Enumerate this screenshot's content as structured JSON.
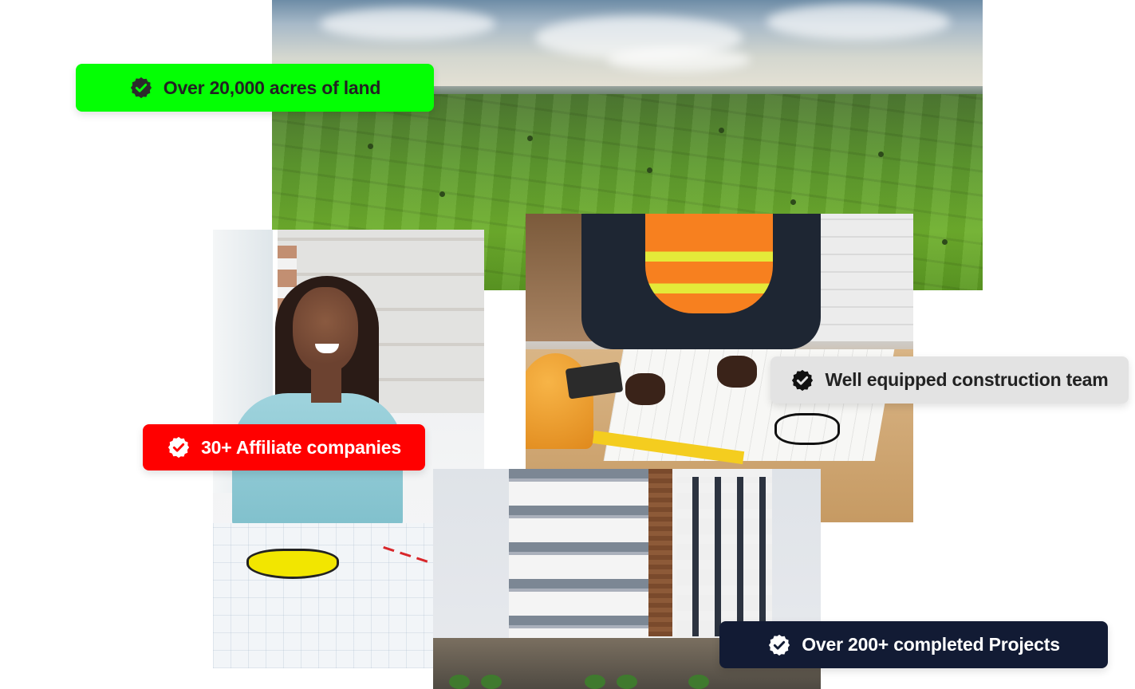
{
  "highlights": [
    {
      "label": "Over 20,000 acres of land",
      "icon": "verified-check-icon",
      "background": "#04ff04",
      "text_color": "#222222"
    },
    {
      "label": "30+ Affiliate companies",
      "icon": "verified-check-icon",
      "background": "#ff0000",
      "text_color": "#ffffff"
    },
    {
      "label": "Well equipped construction team",
      "icon": "verified-check-icon",
      "background": "#e3e3e3",
      "text_color": "#222222"
    },
    {
      "label": "Over 200+ completed Projects",
      "icon": "verified-check-icon",
      "background": "#121b34",
      "text_color": "#ffffff"
    }
  ]
}
